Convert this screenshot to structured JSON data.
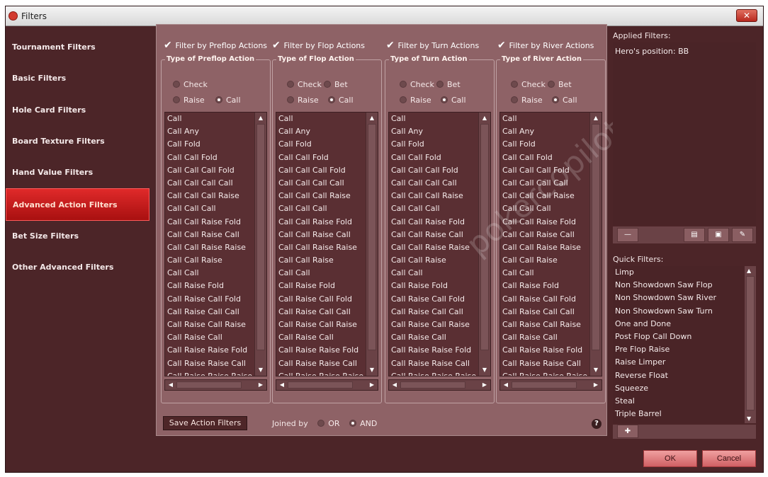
{
  "window": {
    "title": "Filters"
  },
  "sidebar": {
    "items": [
      {
        "label": "Tournament Filters"
      },
      {
        "label": "Basic Filters"
      },
      {
        "label": "Hole Card Filters"
      },
      {
        "label": "Board Texture Filters"
      },
      {
        "label": "Hand Value Filters"
      },
      {
        "label": "Advanced Action Filters",
        "active": true
      },
      {
        "label": "Bet Size Filters"
      },
      {
        "label": "Other Advanced Filters"
      }
    ]
  },
  "columns": [
    {
      "checkbox": "Filter by Preflop Actions",
      "group": "Type of Preflop Action",
      "radios": {
        "check": "Check",
        "raise": "Raise",
        "call": "Call"
      }
    },
    {
      "checkbox": "Filter by Flop Actions",
      "group": "Type of Flop Action",
      "radios": {
        "check": "Check",
        "bet": "Bet",
        "raise": "Raise",
        "call": "Call"
      }
    },
    {
      "checkbox": "Filter by Turn Actions",
      "group": "Type of Turn Action",
      "radios": {
        "check": "Check",
        "bet": "Bet",
        "raise": "Raise",
        "call": "Call"
      }
    },
    {
      "checkbox": "Filter by River Actions",
      "group": "Type of River Action",
      "radios": {
        "check": "Check",
        "bet": "Bet",
        "raise": "Raise",
        "call": "Call"
      }
    }
  ],
  "action_list": [
    "Call",
    "Call Any",
    "Call Fold",
    "Call Call Fold",
    "Call Call Call Fold",
    "Call Call Call Call",
    "Call Call Call Raise",
    "Call Call Call",
    "Call Call Raise Fold",
    "Call Call Raise Call",
    "Call Call Raise Raise",
    "Call Call Raise",
    "Call Call",
    "Call Raise Fold",
    "Call Raise Call Fold",
    "Call Raise Call Call",
    "Call Raise Call Raise",
    "Call Raise Call",
    "Call Raise Raise Fold",
    "Call Raise Raise Call",
    "Call Raise Raise Raise"
  ],
  "footer": {
    "save_label": "Save Action Filters",
    "joined_by": "Joined by",
    "or_label": "OR",
    "and_label": "AND",
    "help": "?"
  },
  "applied": {
    "label": "Applied Filters:",
    "value": "Hero's position: BB"
  },
  "quick": {
    "label": "Quick Filters:",
    "items": [
      "Limp",
      "Non Showdown Saw Flop",
      "Non Showdown Saw River",
      "Non Showdown Saw Turn",
      "One and Done",
      "Post Flop Call Down",
      "Pre Flop Raise",
      "Raise Limper",
      "Reverse Float",
      "Squeeze",
      "Steal",
      "Triple Barrel"
    ]
  },
  "buttons": {
    "ok": "OK",
    "cancel": "Cancel"
  },
  "watermark": "pokercopilot.com",
  "icons": {
    "close": "close-icon",
    "app": "app-logo-icon"
  }
}
